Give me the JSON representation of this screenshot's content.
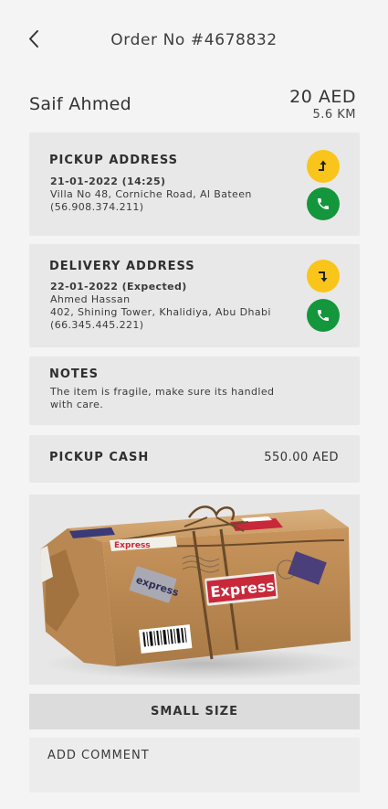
{
  "header": {
    "title": "Order No #4678832",
    "back_icon": "chevron-left-icon"
  },
  "customer": {
    "name": "Saif Ahmed",
    "fare": "20 AED",
    "distance": "5.6 KM"
  },
  "pickup": {
    "title": "PICKUP ADDRESS",
    "datetime": "21-01-2022 (14:25)",
    "address": "Villa No 48, Corniche Road, Al Bateen",
    "phone": "(56.908.374.211)",
    "navigate_icon": "navigate-turn-icon",
    "call_icon": "phone-icon"
  },
  "delivery": {
    "title": "DELIVERY ADDRESS",
    "datetime": "22-01-2022 (Expected)",
    "recipient": "Ahmed Hassan",
    "address": "402, Shining Tower, Khalidiya, Abu Dhabi",
    "phone": "(66.345.445.221)",
    "navigate_icon": "navigate-turn-icon",
    "call_icon": "phone-icon"
  },
  "notes": {
    "title": "NOTES",
    "text": "The item is fragile, make sure its handled with care."
  },
  "cash": {
    "title": "PICKUP CASH",
    "amount": "550.00 AED"
  },
  "package": {
    "label_big": "Express",
    "label_small": "express",
    "label_top": "Express"
  },
  "size": {
    "label": "SMALL SIZE"
  },
  "comment": {
    "label": "ADD COMMENT"
  },
  "colors": {
    "accent_yellow": "#f9c51a",
    "accent_green": "#14963d",
    "card_bg": "#e8e8e8",
    "page_bg": "#f4f4f4"
  }
}
